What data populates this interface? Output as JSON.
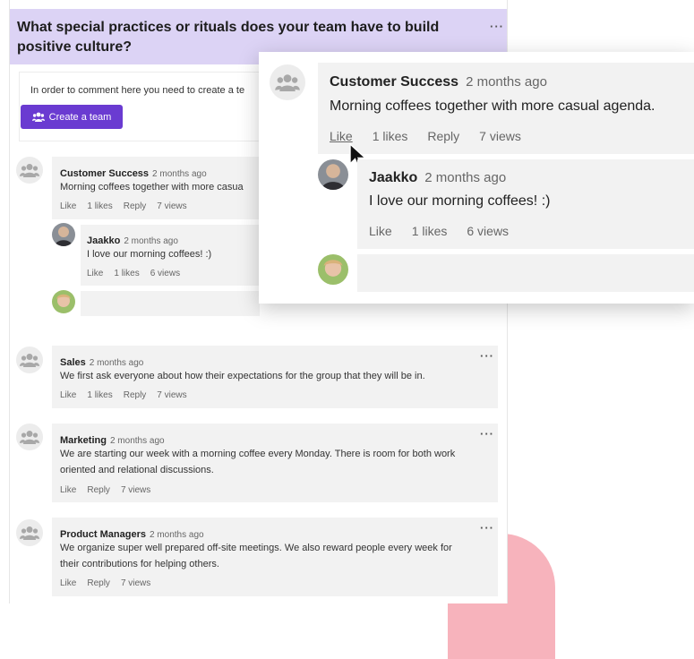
{
  "question": {
    "title": "What special practices or rituals does your team have to build positive culture?",
    "more": "···"
  },
  "notice": {
    "text": "In order to comment here you need to create a te",
    "button_label": "Create a team"
  },
  "comments": [
    {
      "author": "Customer Success",
      "time": "2 months ago",
      "text": "Morning coffees together with more casua",
      "actions": {
        "like": "Like",
        "likes": "1 likes",
        "reply": "Reply",
        "views": "7 views"
      },
      "reply": {
        "author": "Jaakko",
        "time": "2 months ago",
        "text": "I love our morning coffees! :)",
        "actions": {
          "like": "Like",
          "likes": "1 likes",
          "views": "6 views"
        }
      }
    },
    {
      "author": "Sales",
      "time": "2 months ago",
      "text": "We first ask everyone about how their expectations for the group that they will be in.",
      "actions": {
        "like": "Like",
        "likes": "1 likes",
        "reply": "Reply",
        "views": "7 views"
      }
    },
    {
      "author": "Marketing",
      "time": "2 months ago",
      "text_line1": "We are starting our week with a morning coffee every Monday. There is room for both work",
      "text_line2": "oriented and relational discussions.",
      "actions": {
        "like": "Like",
        "reply": "Reply",
        "views": "7 views"
      }
    },
    {
      "author": "Product Managers",
      "time": "2 months ago",
      "text_line1": "We organize super well prepared off-site meetings. We also reward people every week for",
      "text_line2": "their contributions for helping others.",
      "actions": {
        "like": "Like",
        "reply": "Reply",
        "views": "7 views"
      }
    }
  ],
  "popup": {
    "author": "Customer Success",
    "time": "2 months ago",
    "text": "Morning coffees together with more casual agenda.",
    "actions": {
      "like": "Like",
      "likes": "1 likes",
      "reply": "Reply",
      "views": "7 views"
    },
    "reply": {
      "author": "Jaakko",
      "time": "2 months ago",
      "text": "I love our morning coffees! :)",
      "actions": {
        "like": "Like",
        "likes": "1 likes",
        "views": "6 views"
      }
    }
  },
  "colors": {
    "accent": "#6a3bd1",
    "question_bg": "#dcd3f5",
    "blob": "#f7b3bc"
  }
}
